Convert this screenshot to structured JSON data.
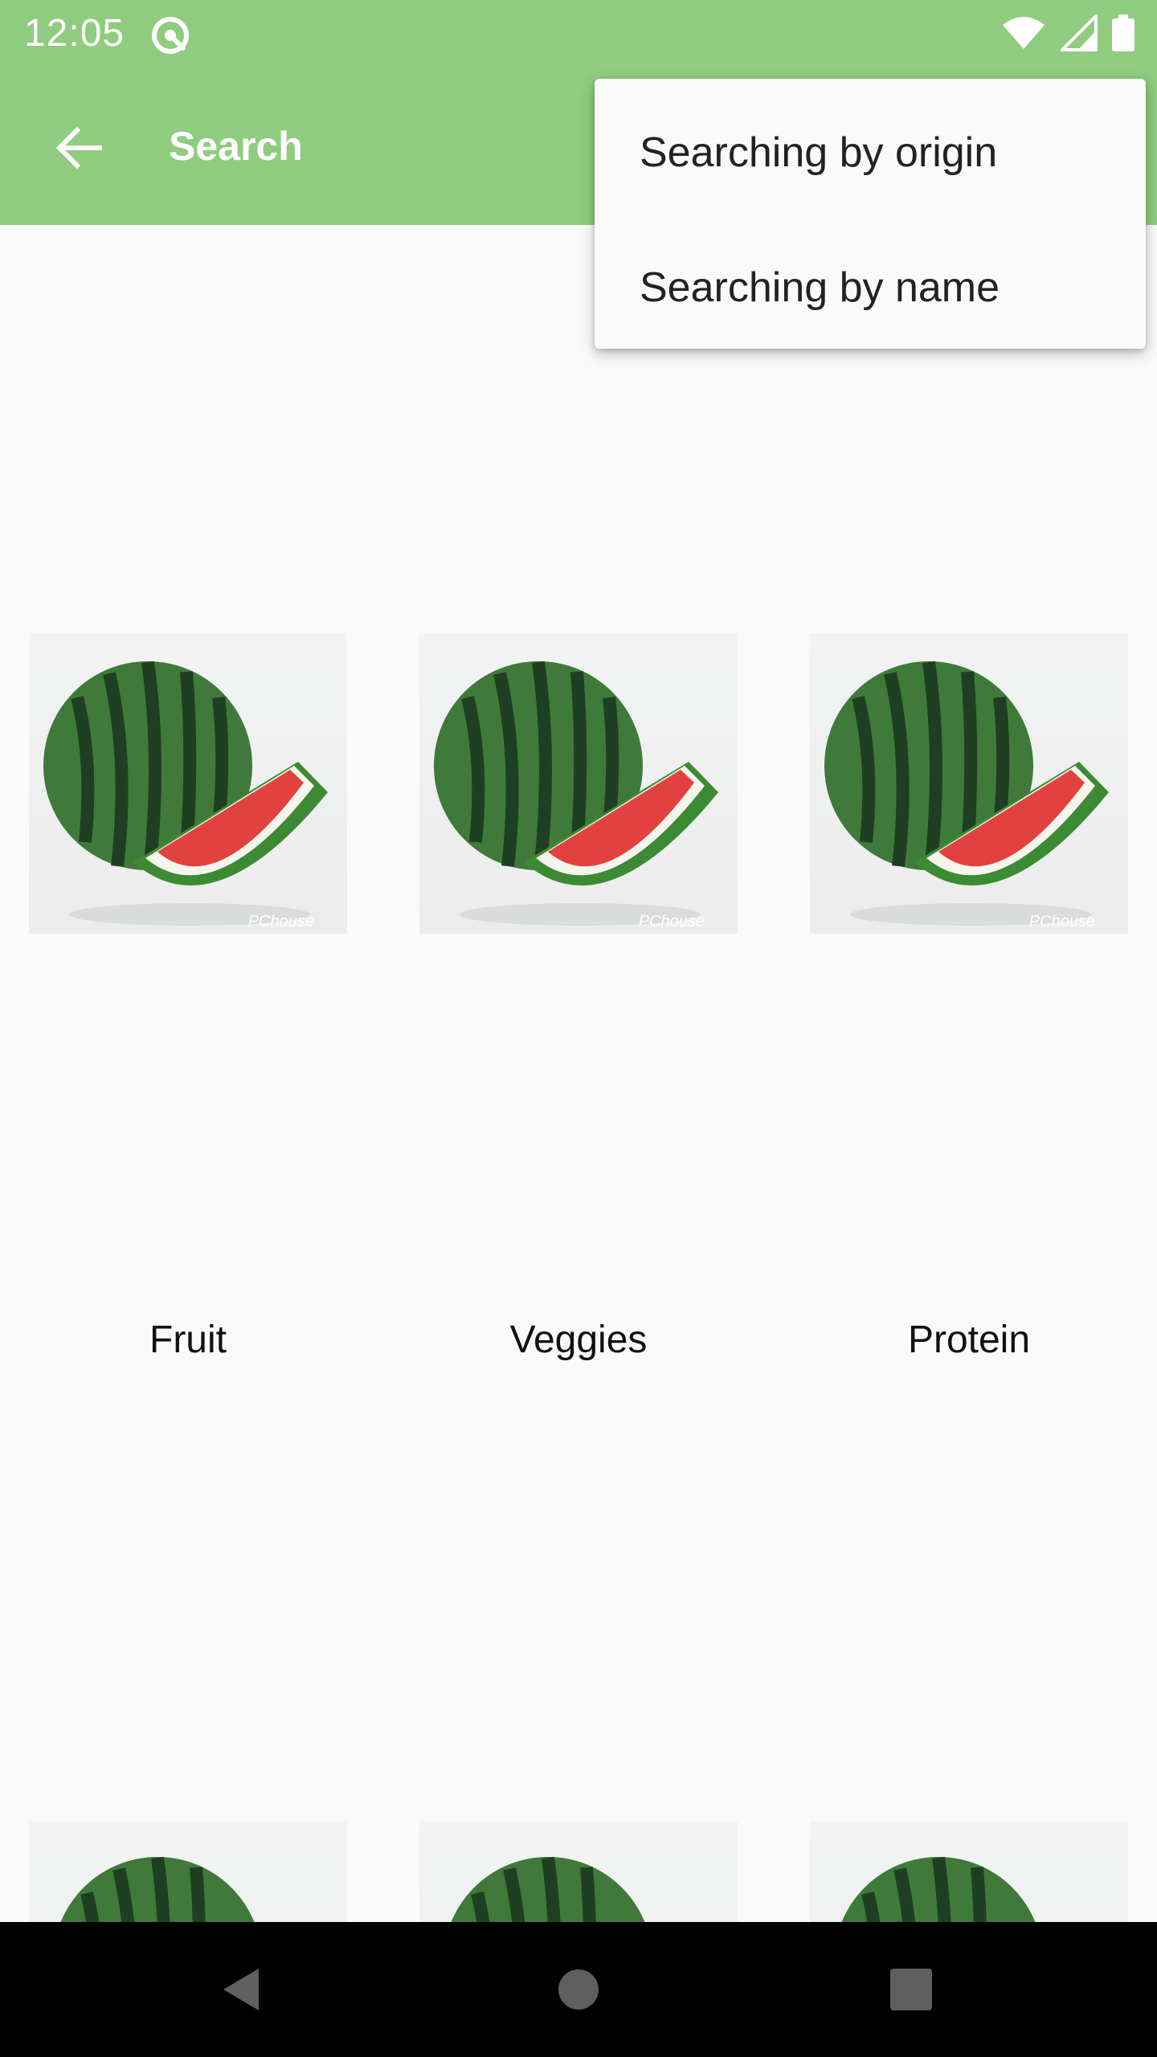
{
  "status_bar": {
    "time": "12:05",
    "icons": [
      "app-notification-icon",
      "wifi-icon",
      "cellular-signal-icon",
      "battery-icon"
    ]
  },
  "app_bar": {
    "title": "Search",
    "back_icon": "arrow-back-icon",
    "background_color": "#8fcc7f"
  },
  "overflow_menu": {
    "items": [
      {
        "label": "Searching by origin"
      },
      {
        "label": "Searching by name"
      }
    ]
  },
  "categories": [
    {
      "label": "Fruit",
      "image": "watermelon-image",
      "watermark": "PChouse"
    },
    {
      "label": "Veggies",
      "image": "watermelon-image",
      "watermark": "PChouse"
    },
    {
      "label": "Protein",
      "image": "watermelon-image",
      "watermark": "PChouse"
    }
  ],
  "second_row": [
    {
      "image": "watermelon-image"
    },
    {
      "image": "watermelon-image"
    },
    {
      "image": "watermelon-image"
    }
  ],
  "nav_bar": {
    "buttons": [
      "back-triangle-icon",
      "home-circle-icon",
      "recents-square-icon"
    ]
  }
}
